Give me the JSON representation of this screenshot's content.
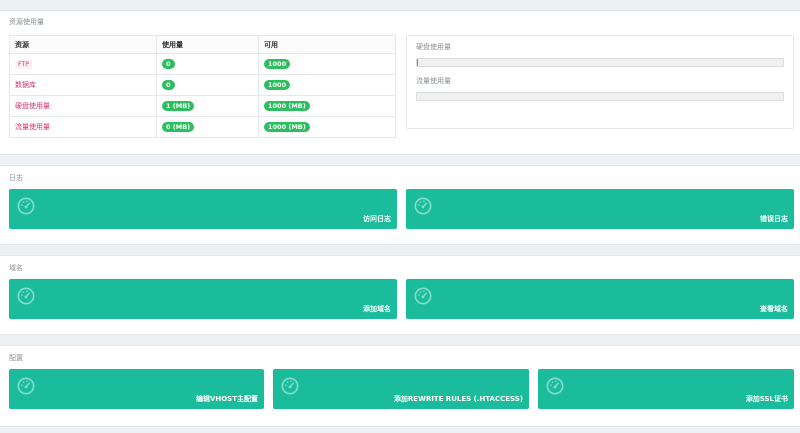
{
  "resources": {
    "title": "资源使用量",
    "table": {
      "headers": [
        "资源",
        "使用量",
        "可用"
      ],
      "rows": [
        {
          "name": "FTP",
          "used": "0",
          "available": "1000"
        },
        {
          "name": "数据库",
          "used": "0",
          "available": "1000"
        },
        {
          "name": "硬盘使用量",
          "used": "1 (MB)",
          "available": "1000 (MB)"
        },
        {
          "name": "流量使用量",
          "used": "0 (MB)",
          "available": "1000 (MB)"
        }
      ]
    },
    "gauges": {
      "disk_label": "硬盘使用量",
      "disk_fraction": 0.001,
      "traffic_label": "流量使用量",
      "traffic_fraction": 0
    }
  },
  "logs": {
    "title": "日志",
    "tiles": [
      {
        "label": "访问日志",
        "icon": "dashboard-icon"
      },
      {
        "label": "错误日志",
        "icon": "dashboard-icon"
      }
    ]
  },
  "domains": {
    "title": "域名",
    "tiles": [
      {
        "label": "添加域名",
        "icon": "dashboard-icon"
      },
      {
        "label": "查看域名",
        "icon": "dashboard-icon"
      }
    ]
  },
  "config": {
    "title": "配置",
    "tiles": [
      {
        "label": "编辑VHOST主配置",
        "icon": "dashboard-icon"
      },
      {
        "label": "添加REWRITE RULES (.HTACCESS)",
        "icon": "dashboard-icon"
      },
      {
        "label": "添加SSL证书",
        "icon": "dashboard-icon"
      }
    ]
  },
  "colors": {
    "tile": "#1abc9c",
    "badge": "#2dbe60",
    "resource_name": "#d6336c"
  }
}
